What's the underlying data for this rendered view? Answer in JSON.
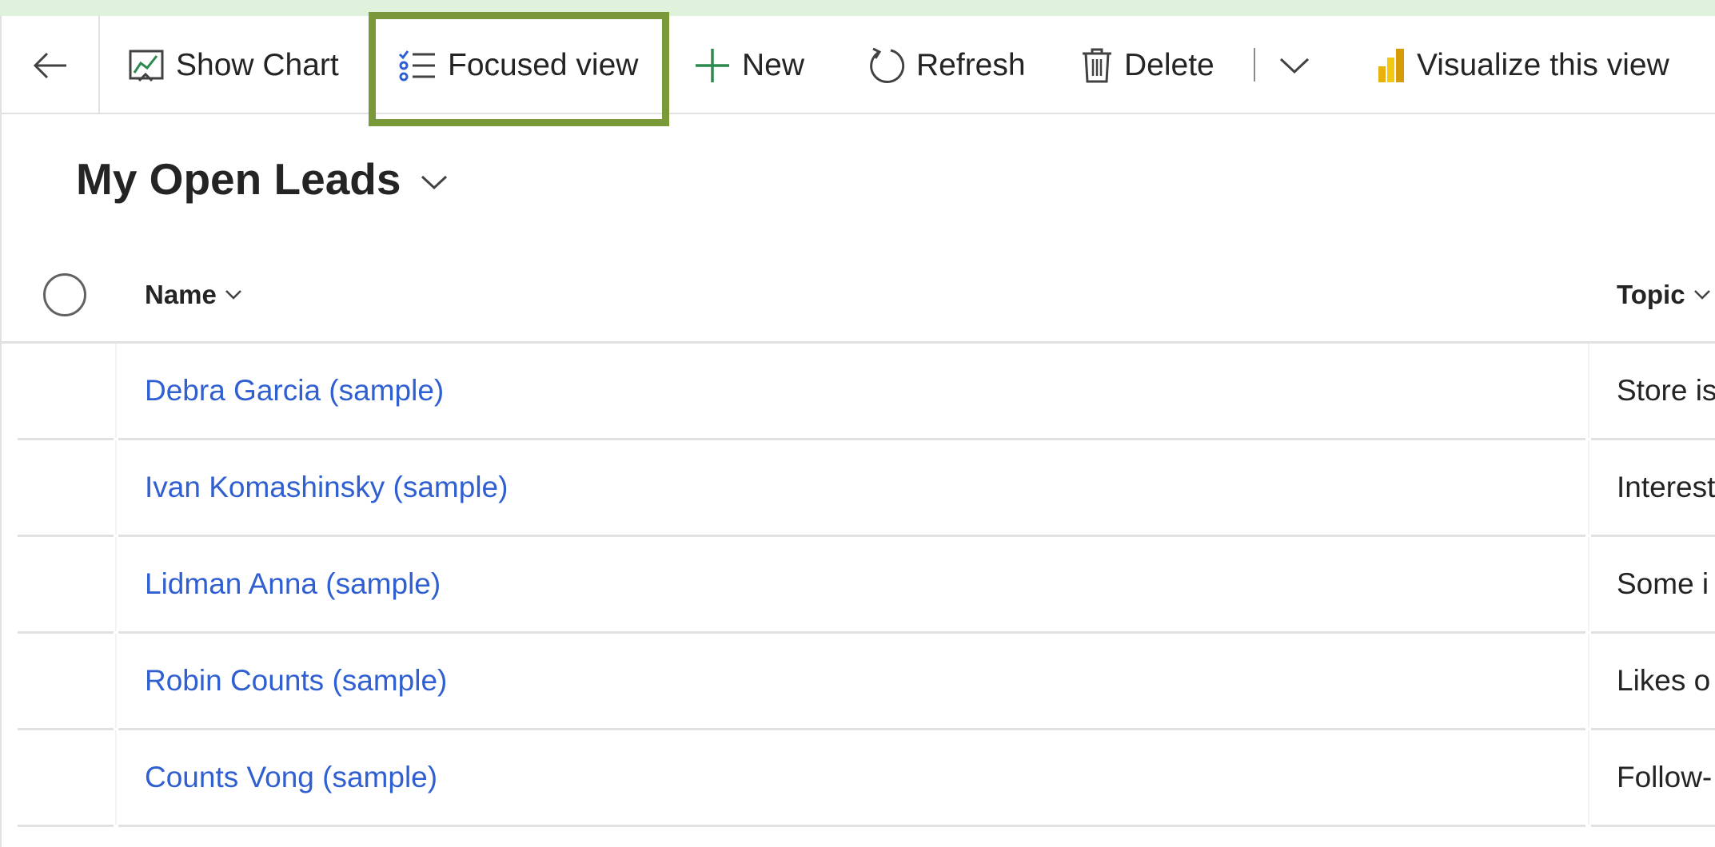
{
  "toolbar": {
    "show_chart": "Show Chart",
    "focused_view": "Focused view",
    "new": "New",
    "refresh": "Refresh",
    "delete": "Delete",
    "visualize": "Visualize this view",
    "highlight_color": "#7a9a3a",
    "icons": [
      "back-arrow-icon",
      "show-chart-icon",
      "focused-view-icon",
      "plus-icon",
      "refresh-icon",
      "trash-icon",
      "chevron-down-icon",
      "power-bi-icon"
    ]
  },
  "view": {
    "title": "My Open Leads"
  },
  "grid": {
    "columns": [
      {
        "label": "Name"
      },
      {
        "label": "Topic"
      }
    ],
    "rows": [
      {
        "name": "Debra Garcia (sample)",
        "topic": "Store is"
      },
      {
        "name": "Ivan Komashinsky (sample)",
        "topic": "Interest"
      },
      {
        "name": "Lidman Anna (sample)",
        "topic": "Some i"
      },
      {
        "name": "Robin Counts (sample)",
        "topic": "Likes o"
      },
      {
        "name": "Counts Vong (sample)",
        "topic": "Follow-"
      }
    ],
    "link_color": "#2f5fd0"
  }
}
